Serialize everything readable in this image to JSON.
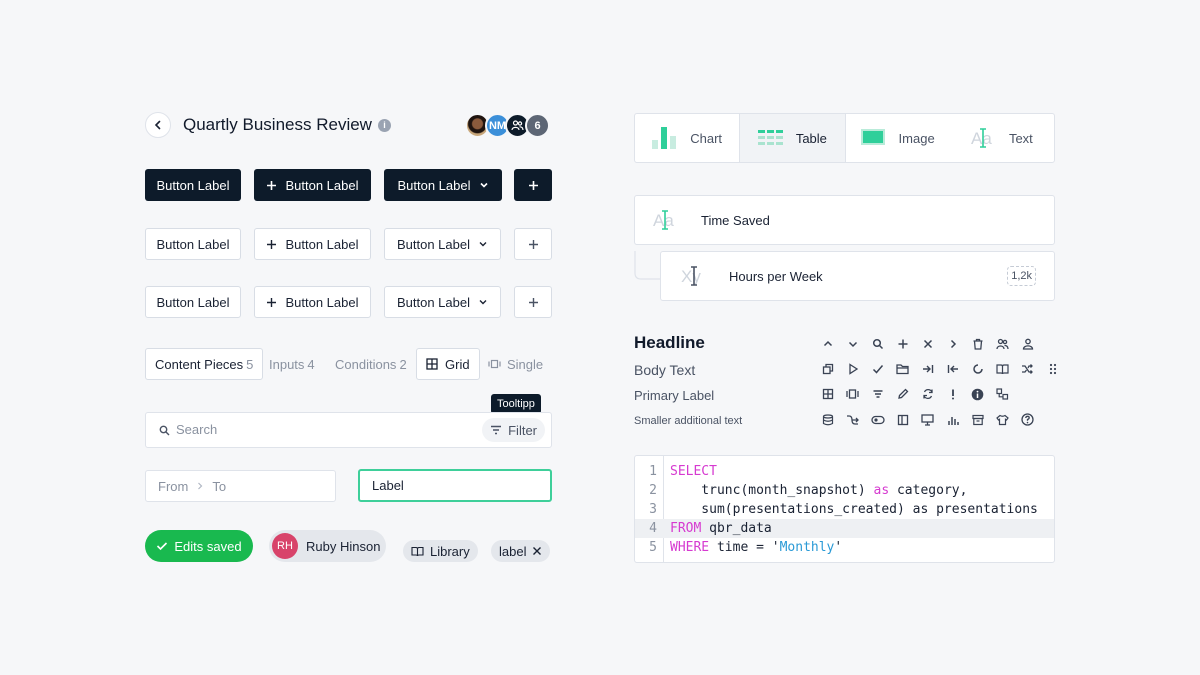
{
  "header": {
    "title": "Quartly Business Review",
    "info_glyph": "i",
    "avatars": [
      {
        "type": "photo",
        "initials": ""
      },
      {
        "type": "initials",
        "initials": "NM"
      },
      {
        "type": "group-icon",
        "initials": ""
      },
      {
        "type": "count",
        "initials": "6"
      }
    ]
  },
  "buttons": {
    "label": "Button Label",
    "rows": [
      "dark",
      "light",
      "light"
    ]
  },
  "tabs": {
    "content_pieces": {
      "label": "Content Pieces",
      "count": "5"
    },
    "inputs": {
      "label": "Inputs",
      "count": "4"
    },
    "conditions": {
      "label": "Conditions",
      "count": "2"
    },
    "grid": "Grid",
    "single": "Single"
  },
  "tooltip": "Tooltipp",
  "search": {
    "placeholder": "Search",
    "filter_label": "Filter"
  },
  "range": {
    "from": "From",
    "to": "To"
  },
  "label_field": "Label",
  "status": {
    "saved": "Edits saved"
  },
  "user_chip": {
    "initials": "RH",
    "name": "Ruby Hinson"
  },
  "library_chip": "Library",
  "tag_chip": "label",
  "type_selector": {
    "items": [
      {
        "label": "Chart",
        "icon": "bar-chart-icon"
      },
      {
        "label": "Table",
        "icon": "table-icon",
        "active": true
      },
      {
        "label": "Image",
        "icon": "image-icon"
      },
      {
        "label": "Text",
        "icon": "text-icon"
      }
    ]
  },
  "metrics": {
    "time_saved": "Time Saved",
    "hours_per_week": "Hours per Week",
    "hours_badge": "1,2k"
  },
  "typography": {
    "headline": "Headline",
    "body": "Body Text",
    "primary_label": "Primary Label",
    "small": "Smaller additional text"
  },
  "icons": [
    "chevron-up-icon",
    "chevron-down-icon",
    "search-icon",
    "plus-icon",
    "close-icon",
    "chevron-right-icon",
    "trash-icon",
    "users-icon",
    "user-icon",
    "",
    "copy-icon",
    "play-icon",
    "check-icon",
    "folder-icon",
    "arrow-right-to-line-icon",
    "arrow-left-to-line-icon",
    "loading-icon",
    "book-icon",
    "shuffle-icon",
    "drag-handle-icon",
    "grid-icon",
    "carousel-icon",
    "filter-icon",
    "pencil-icon",
    "refresh-icon",
    "alert-icon",
    "info-circle-icon",
    "nodes-icon",
    "",
    "",
    "database-icon",
    "branch-icon",
    "toggle-icon",
    "sidebar-icon",
    "presentation-icon",
    "bar-chart-icon",
    "archive-icon",
    "shirt-icon",
    "help-icon",
    ""
  ],
  "code": {
    "lines": [
      {
        "n": "1",
        "parts": [
          [
            "kw",
            "SELECT"
          ]
        ]
      },
      {
        "n": "2",
        "parts": [
          [
            "",
            "    trunc(month_snapshot) "
          ],
          [
            "kw",
            "as"
          ],
          [
            "",
            " category,"
          ]
        ]
      },
      {
        "n": "3",
        "parts": [
          [
            "",
            "    sum(presentations_created) as presentations"
          ]
        ]
      },
      {
        "n": "4",
        "parts": [
          [
            "kw",
            "FROM"
          ],
          [
            "",
            " qbr_data"
          ]
        ],
        "highlight": true
      },
      {
        "n": "5",
        "parts": [
          [
            "kw",
            "WHERE"
          ],
          [
            "",
            " time = '"
          ],
          [
            "str",
            "Monthly"
          ],
          [
            "",
            "'"
          ]
        ]
      }
    ]
  }
}
